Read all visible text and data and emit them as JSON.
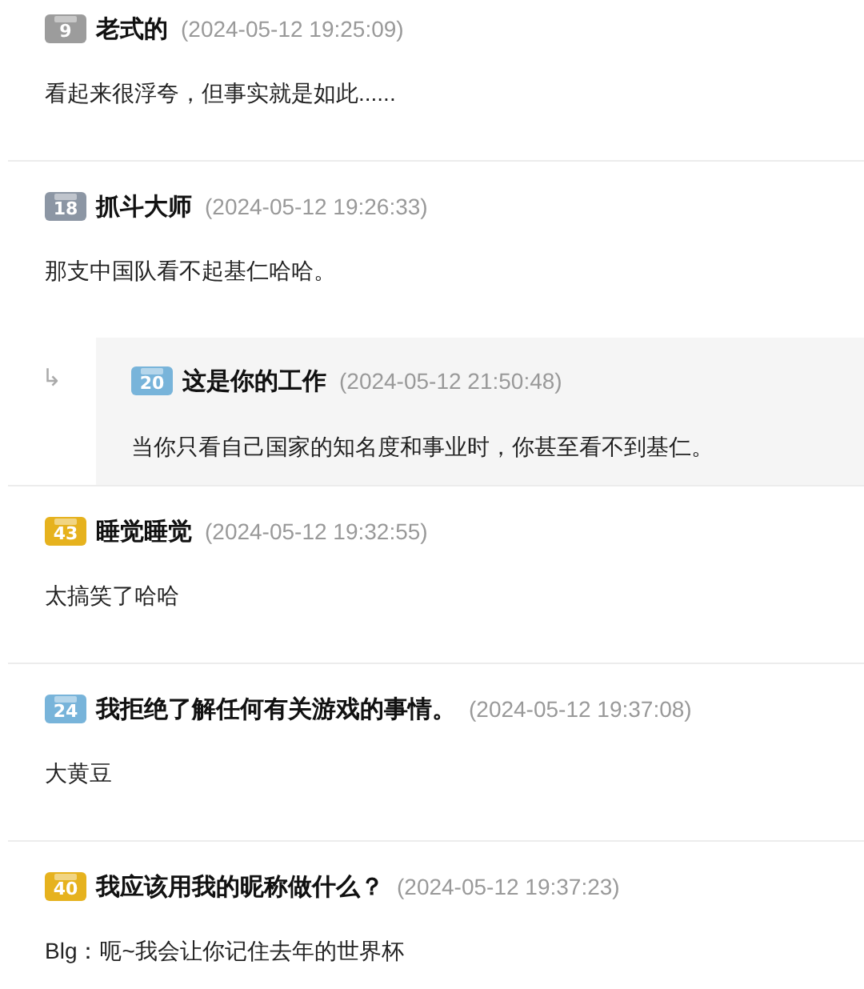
{
  "comments": [
    {
      "level": "9",
      "color": "#9c9c9c",
      "name": "老式的",
      "time": "(2024-05-12 19:25:09)",
      "text": "看起来很浮夸，但事实就是如此......"
    },
    {
      "level": "18",
      "color": "#8c96a4",
      "name": "抓斗大师",
      "time": "(2024-05-12 19:26:33)",
      "text": "那支中国队看不起基仁哈哈。",
      "replies": [
        {
          "reply_icon": "↳",
          "level": "20",
          "color": "#78b4da",
          "name": "这是你的工作",
          "time": "(2024-05-12 21:50:48)",
          "text": "当你只看自己国家的知名度和事业时，你甚至看不到基仁。"
        }
      ]
    },
    {
      "level": "43",
      "color": "#e6b21e",
      "name": "睡觉睡觉",
      "time": "(2024-05-12 19:32:55)",
      "text": "太搞笑了哈哈"
    },
    {
      "level": "24",
      "color": "#78b4da",
      "name": "我拒绝了解任何有关游戏的事情。",
      "time": "(2024-05-12 19:37:08)",
      "text": "大黄豆"
    },
    {
      "level": "40",
      "color": "#e6b21e",
      "name": "我应该用我的昵称做什么？",
      "time": "(2024-05-12 19:37:23)",
      "text": "Blg：呃~我会让你记住去年的世界杯"
    }
  ]
}
